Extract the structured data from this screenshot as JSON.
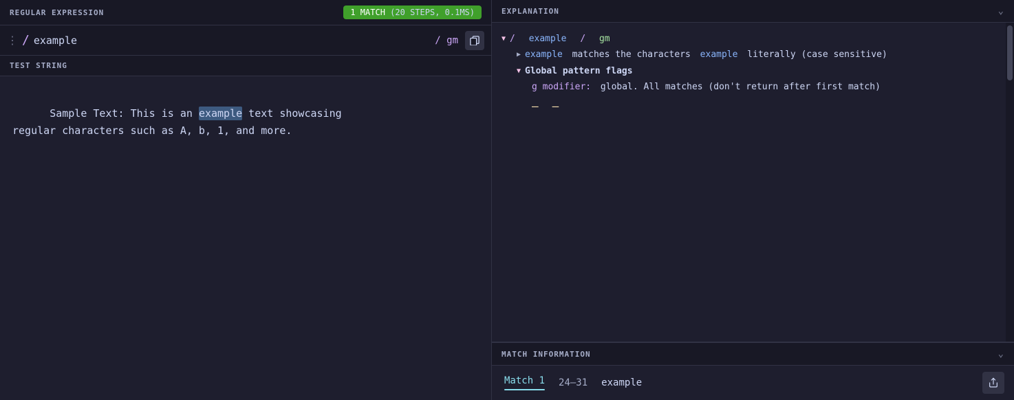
{
  "left": {
    "regex_section_label": "REGULAR EXPRESSION",
    "match_badge": "1 match",
    "match_steps": "(20 steps, 0.1ms)",
    "regex_dots": "⋮",
    "regex_slash_open": "/",
    "regex_value": "example",
    "regex_slash_flags": "/ gm",
    "test_section_label": "TEST STRING",
    "test_text_before": "Sample Text: This is an ",
    "test_highlight": "example",
    "test_text_after": " text showcasing\nregular characters such as A, b, 1, and more."
  },
  "right": {
    "explanation_label": "EXPLANATION",
    "tree": {
      "root_slash": "/",
      "root_example": "example",
      "root_slash2": "/",
      "root_gm": "gm",
      "child1_mono": "example",
      "child1_text": "matches the characters",
      "child1_mono2": "example",
      "child1_text2": "literally (case sensitive)",
      "child2_label": "Global pattern flags",
      "child2_mono": "g modifier:",
      "child2_text": "global. All matches (don't return after first match)"
    },
    "match_info_label": "MATCH INFORMATION",
    "match_tab": "Match 1",
    "match_range": "24–31",
    "match_value": "example"
  }
}
